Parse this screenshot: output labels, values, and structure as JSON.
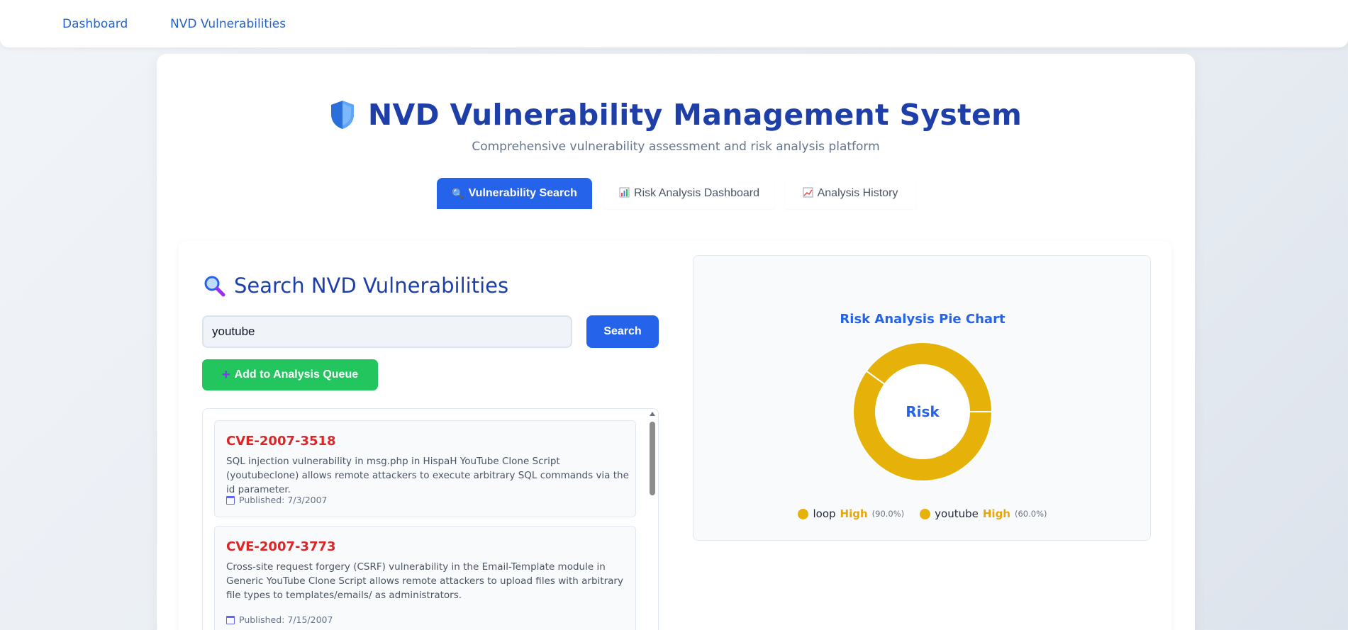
{
  "nav": {
    "dashboard": "Dashboard",
    "nvd": "NVD Vulnerabilities"
  },
  "header": {
    "title": "NVD Vulnerability Management System",
    "subtitle": "Comprehensive vulnerability assessment and risk analysis platform"
  },
  "tabs": [
    {
      "label": "Vulnerability Search",
      "icon": "magnifier-icon",
      "active": true
    },
    {
      "label": "Risk Analysis Dashboard",
      "icon": "bar-chart-icon",
      "active": false
    },
    {
      "label": "Analysis History",
      "icon": "line-chart-icon",
      "active": false
    }
  ],
  "search": {
    "heading": "Search NVD Vulnerabilities",
    "value": "youtube",
    "button": "Search",
    "queue_button": "Add to Analysis Queue"
  },
  "results": [
    {
      "id": "CVE-2007-3518",
      "description": "SQL injection vulnerability in msg.php in HispaH YouTube Clone Script (youtubeclone) allows remote attackers to execute arbitrary SQL commands via the id parameter.",
      "published": "Published: 7/3/2007"
    },
    {
      "id": "CVE-2007-3773",
      "description": "Cross-site request forgery (CSRF) vulnerability in the Email-Template module in Generic YouTube Clone Script allows remote attackers to upload files with arbitrary file types to templates/emails/ as administrators.",
      "published": "Published: 7/15/2007"
    }
  ],
  "chart_data": {
    "type": "pie",
    "title": "Risk Analysis Pie Chart",
    "center_label": "Risk",
    "series": [
      {
        "name": "loop",
        "level": "High",
        "pct_label": "(90.0%)",
        "value": 90,
        "color": "#e6b20a"
      },
      {
        "name": "youtube",
        "level": "High",
        "pct_label": "(60.0%)",
        "value": 60,
        "color": "#e6b20a"
      }
    ]
  },
  "colors": {
    "primary": "#2563eb",
    "success": "#22c55e",
    "danger": "#dc2626",
    "warning": "#e6b20a",
    "title": "#1e3fa8"
  }
}
